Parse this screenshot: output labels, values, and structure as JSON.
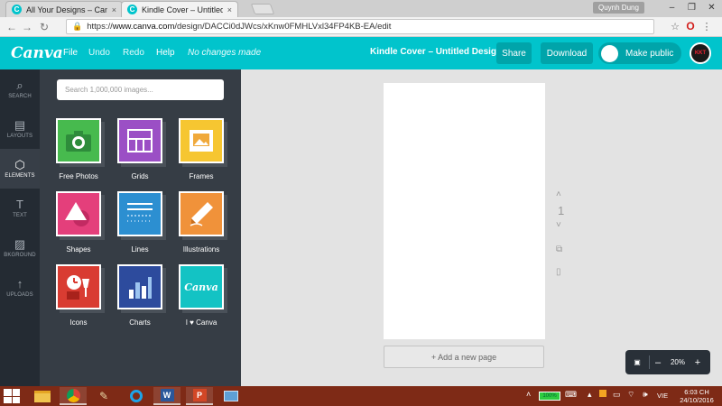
{
  "browser": {
    "tabs": [
      {
        "favicon": "C",
        "label": "All Your Designs – Canva",
        "close": "×"
      },
      {
        "favicon": "C",
        "label": "Kindle Cover – Untitled D",
        "close": "×"
      }
    ],
    "user": "Quynh Dung",
    "window_controls": [
      "–",
      "❐",
      "✕"
    ],
    "url_scheme": "https://",
    "url_domain": "www.canva.com",
    "url_path": "/design/DACCi0dJWcs/xKnw0FMHLVxl34FP4KB-EA/edit"
  },
  "toolbar": {
    "logo": "Canva",
    "menu": [
      "File",
      "Undo",
      "Redo",
      "Help"
    ],
    "status": "No changes made",
    "design_title": "Kindle Cover – Untitled Design",
    "share": "Share",
    "download": "Download",
    "make_public": "Make public",
    "avatar_text": "KKT"
  },
  "sidebar": {
    "items": [
      {
        "icon": "search-icon",
        "glyph": "⌕",
        "label": "SEARCH"
      },
      {
        "icon": "layouts-icon",
        "glyph": "▤",
        "label": "LAYOUTS"
      },
      {
        "icon": "elements-icon",
        "glyph": "⬡",
        "label": "ELEMENTS",
        "active": true
      },
      {
        "icon": "text-icon",
        "glyph": "T",
        "label": "TEXT"
      },
      {
        "icon": "background-icon",
        "glyph": "▨",
        "label": "BKGROUND"
      },
      {
        "icon": "upload-icon",
        "glyph": "↑",
        "label": "UPLOADS"
      }
    ]
  },
  "panel": {
    "search_placeholder": "Search 1,000,000 images...",
    "tiles": [
      {
        "label": "Free Photos",
        "color": "#47ba4e",
        "icon": "camera-icon"
      },
      {
        "label": "Grids",
        "color": "#9b4fc5",
        "icon": "grid-icon"
      },
      {
        "label": "Frames",
        "color": "#f6c631",
        "icon": "frame-icon"
      },
      {
        "label": "Shapes",
        "color": "#e43f7b",
        "icon": "shapes-icon"
      },
      {
        "label": "Lines",
        "color": "#2c8fd1",
        "icon": "lines-icon"
      },
      {
        "label": "Illustrations",
        "color": "#f0923a",
        "icon": "pencil-icon"
      },
      {
        "label": "Icons",
        "color": "#d93c32",
        "icon": "clock-icon"
      },
      {
        "label": "Charts",
        "color": "#2d4b9d",
        "icon": "bar-chart-icon"
      },
      {
        "label": "I ♥ Canva",
        "color": "#13c3c4",
        "icon": "canva-logo-icon"
      }
    ]
  },
  "canvas": {
    "page_number": "1",
    "add_page": "+ Add a new page",
    "zoom": "20%",
    "zoom_minus": "–",
    "zoom_plus": "+"
  },
  "taskbar": {
    "battery": "100%",
    "language": "VIE",
    "time": "6:03 CH",
    "date": "24/10/2016"
  },
  "colors": {
    "brand": "#01c4cc",
    "rail": "#242b33",
    "panel": "#363d45",
    "taskbar": "#7e2a16"
  }
}
